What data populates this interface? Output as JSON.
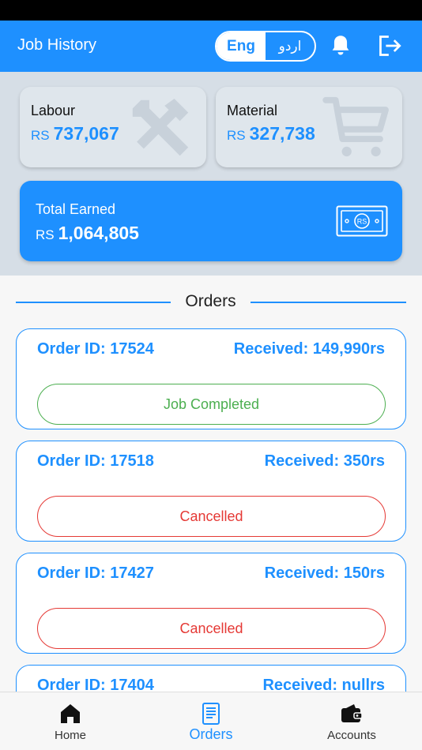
{
  "header": {
    "title": "Job History",
    "lang_eng": "Eng",
    "lang_urdu": "اردو"
  },
  "summary": {
    "labour": {
      "label": "Labour",
      "currency": "RS",
      "amount": "737,067"
    },
    "material": {
      "label": "Material",
      "currency": "RS",
      "amount": "327,738"
    },
    "total": {
      "label": "Total Earned",
      "currency": "RS",
      "amount": "1,064,805"
    }
  },
  "orders_section": {
    "title": "Orders"
  },
  "orders": [
    {
      "id": "Order ID: 17524",
      "received": "Received: 149,990rs",
      "status": "Job Completed"
    },
    {
      "id": "Order ID: 17518",
      "received": "Received: 350rs",
      "status": "Cancelled"
    },
    {
      "id": "Order ID: 17427",
      "received": "Received: 150rs",
      "status": "Cancelled"
    },
    {
      "id": "Order ID: 17404",
      "received": "Received: nullrs",
      "status": ""
    }
  ],
  "nav": {
    "home": "Home",
    "orders": "Orders",
    "accounts": "Accounts"
  },
  "colors": {
    "primary": "#1e90ff",
    "completed": "#4caf50",
    "cancelled": "#e53935"
  }
}
